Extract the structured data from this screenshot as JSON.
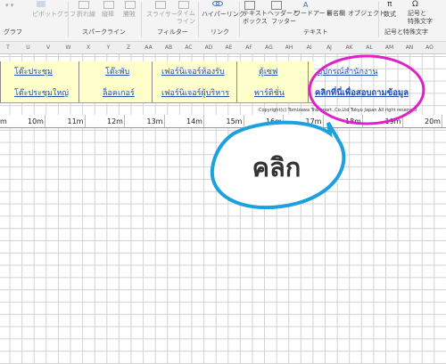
{
  "ribbon": {
    "top_items": [
      {
        "label": "ピボットグラフ",
        "dim": true
      },
      {
        "label": "折れ線",
        "dim": true
      },
      {
        "label": "縦棒",
        "dim": true
      },
      {
        "label": "勝敗",
        "dim": true
      },
      {
        "label": "スライサー",
        "dim": true
      },
      {
        "label": "タイム",
        "dim": true
      },
      {
        "label": "ライン",
        "dim": true
      },
      {
        "label": "ハイパーリンク",
        "dim": false
      },
      {
        "label": "テキスト",
        "dim": false
      },
      {
        "label": "ボックス",
        "dim": false
      },
      {
        "label": "ヘッダーと",
        "dim": false
      },
      {
        "label": "フッター",
        "dim": false
      },
      {
        "label": "ワードアート",
        "dim": false
      },
      {
        "label": "署名欄",
        "dim": false
      },
      {
        "label": "オブジェクト",
        "dim": false
      },
      {
        "label": "数式",
        "dim": false
      },
      {
        "label": "記号と",
        "dim": false
      },
      {
        "label": "特殊文字",
        "dim": false
      }
    ],
    "groups": [
      "グラフ",
      "スパークライン",
      "フィルター",
      "リンク",
      "テキスト",
      "記号と特殊文字"
    ]
  },
  "column_headers": [
    "T",
    "U",
    "V",
    "W",
    "X",
    "Y",
    "Z",
    "AA",
    "AB",
    "AC",
    "AD",
    "AE",
    "AF",
    "AG",
    "AH",
    "AI",
    "AJ",
    "AK",
    "AL",
    "AM",
    "AN",
    "AO"
  ],
  "links_row1": [
    "โต๊ะประชุม",
    "โต๊ะพับ",
    "เฟอร์นิเจอร์ห้องรับ",
    "ตู้เซฟ",
    "อุปกรณ์สำนักงาน"
  ],
  "links_row2": [
    "โต๊ะประชุมใหญ่",
    "ล็อคเกอร์",
    "เฟอร์นิเจอร์ผู้บริหาร",
    "พาร์ติชั่น",
    "คลิกที่นี่เพื่อสอบถามข้อมูล"
  ],
  "copyright": "Copyright(c) Tomizawa Transport.,Co.Ltd Tokyo Japan All right reserved",
  "distances": [
    "10m",
    "11m",
    "12m",
    "13m",
    "14m",
    "15m",
    "16m",
    "17m",
    "18m",
    "19m",
    "20m"
  ],
  "callout": {
    "text": "คลิก",
    "color": "#1ba1de"
  },
  "highlight_color": "#e020c8"
}
